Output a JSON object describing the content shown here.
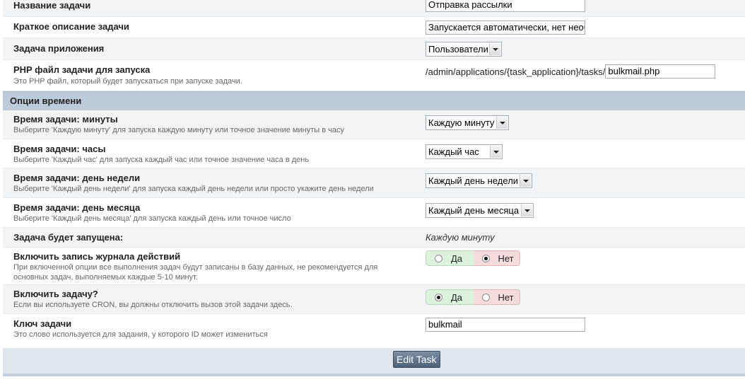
{
  "task_title": {
    "label": "Название задачи",
    "value": "Отправка рассылки"
  },
  "task_desc": {
    "label": "Краткое описание задачи",
    "value": "Запускается автоматически, нет необ"
  },
  "task_app": {
    "label": "Задача приложения",
    "value": "Пользователи"
  },
  "task_file": {
    "label": "PHP файл задачи для запуска",
    "desc": "Это PHP файл, который будет запускаться при запуске задачи.",
    "prefix": "/admin/applications/{task_application}/tasks/",
    "value": "bulkmail.php"
  },
  "section_time": "Опции времени",
  "minutes": {
    "label": "Время задачи: минуты",
    "desc": "Выберите 'Каждую минуту' для запуска каждую минуту или точное значение минуты в часу",
    "value": "Каждую минуту"
  },
  "hours": {
    "label": "Время задачи: часы",
    "desc": "Выберите 'Каждый час' для запуска каждый час или точное значение часа в день",
    "value": "Каждый час"
  },
  "weekday": {
    "label": "Время задачи: день недели",
    "desc": "Выберите 'Каждый день недели' для запуска каждый день недели или просто укажите день недели",
    "value": "Каждый день недели"
  },
  "monthday": {
    "label": "Время задачи: день месяца",
    "desc": "Выберите 'Каждый день месяца' для запуска каждый день или точное число",
    "value": "Каждый день месяца"
  },
  "will_run": {
    "label": "Задача будет запущена:",
    "value": "Каждую минуту"
  },
  "log": {
    "label": "Включить запись журнала действий",
    "desc1": "При включенной опции все выполнения задач будут записаны в базу данных, не рекомендуется для",
    "desc2": "основных задач, выполняемых каждые 5-10 минут.",
    "yes": "Да",
    "no": "Нет",
    "selected": "no"
  },
  "enable": {
    "label": "Включить задачу?",
    "desc": "Если вы используете CRON, вы должны отключить вызов этой задачи здесь.",
    "yes": "Да",
    "no": "Нет",
    "selected": "yes"
  },
  "key": {
    "label": "Ключ задачи",
    "desc": "Это слово используется для задания, у которого ID может измениться",
    "value": "bulkmail"
  },
  "submit": "Edit Task"
}
